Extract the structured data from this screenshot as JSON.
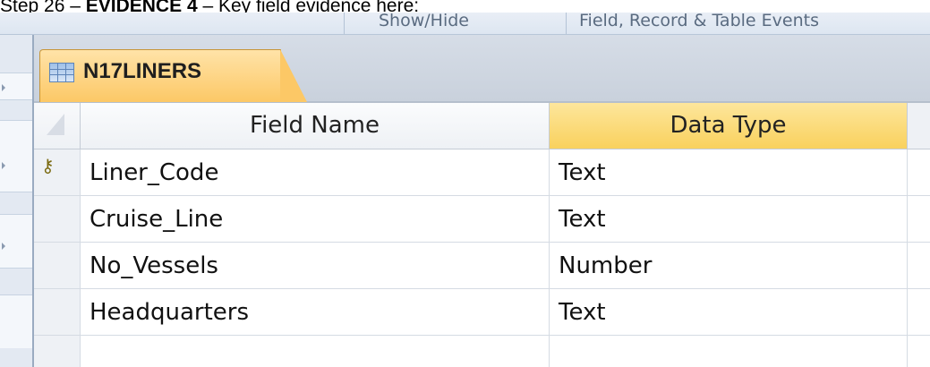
{
  "caption": {
    "prefix": "Step 26 – ",
    "bold": "EVIDENCE 4",
    "suffix": " – Key field evidence here:"
  },
  "ribbon": {
    "group_show_hide": "Show/Hide",
    "group_events": "Field, Record & Table Events"
  },
  "tab": {
    "label": "N17LINERS",
    "icon": "table-icon"
  },
  "grid": {
    "columns": [
      "Field Name",
      "Data Type"
    ],
    "rows": [
      {
        "field": "Liner_Code",
        "type": "Text",
        "primary_key": true
      },
      {
        "field": "Cruise_Line",
        "type": "Text",
        "primary_key": false
      },
      {
        "field": "No_Vessels",
        "type": "Number",
        "primary_key": false
      },
      {
        "field": "Headquarters",
        "type": "Text",
        "primary_key": false
      },
      {
        "field": "",
        "type": "",
        "primary_key": false
      }
    ]
  },
  "colors": {
    "tab_active": "#fcc866",
    "header_selected": "#f9d15d"
  }
}
